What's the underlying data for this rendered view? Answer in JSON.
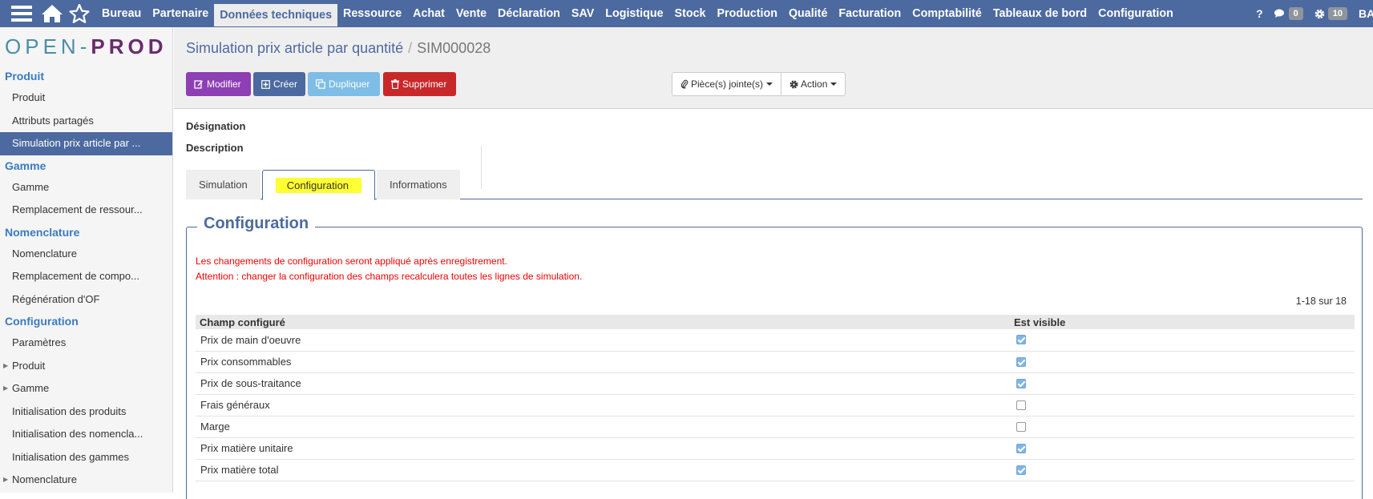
{
  "topbar": {
    "menu": [
      "Bureau",
      "Partenaire",
      "Données techniques",
      "Ressource",
      "Achat",
      "Vente",
      "Déclaration",
      "SAV",
      "Logistique",
      "Stock",
      "Production",
      "Qualité",
      "Facturation",
      "Comptabilité",
      "Tableaux de bord",
      "Configuration"
    ],
    "active_index": 2,
    "help": "?",
    "messages_count": "0",
    "settings_count": "10",
    "user": "BA"
  },
  "logo": {
    "part1": "OPEN",
    "dash": "-",
    "part2": "PROD"
  },
  "sidebar": {
    "items": [
      {
        "type": "section",
        "label": "Produit"
      },
      {
        "type": "item",
        "label": "Produit"
      },
      {
        "type": "item",
        "label": "Attributs partagés"
      },
      {
        "type": "item",
        "label": "Simulation prix article par ...",
        "active": true
      },
      {
        "type": "section",
        "label": "Gamme"
      },
      {
        "type": "item",
        "label": "Gamme"
      },
      {
        "type": "item",
        "label": "Remplacement de ressour..."
      },
      {
        "type": "section",
        "label": "Nomenclature"
      },
      {
        "type": "item",
        "label": "Nomenclature"
      },
      {
        "type": "item",
        "label": "Remplacement de compo..."
      },
      {
        "type": "item",
        "label": "Régénération d'OF"
      },
      {
        "type": "section",
        "label": "Configuration"
      },
      {
        "type": "item",
        "label": "Paramètres"
      },
      {
        "type": "item",
        "label": "Produit",
        "caret": true
      },
      {
        "type": "item",
        "label": "Gamme",
        "caret": true
      },
      {
        "type": "item",
        "label": "Initialisation des produits"
      },
      {
        "type": "item",
        "label": "Initialisation des nomencla..."
      },
      {
        "type": "item",
        "label": "Initialisation des gammes"
      },
      {
        "type": "item",
        "label": "Nomenclature",
        "caret": true
      }
    ]
  },
  "header": {
    "breadcrumb_parent": "Simulation prix article par quantité",
    "breadcrumb_sep": "/",
    "breadcrumb_current": "SIM000028",
    "btn_modifier": "Modifier",
    "btn_creer": "Créer",
    "btn_dupliquer": "Dupliquer",
    "btn_supprimer": "Supprimer",
    "btn_pieces": "Pièce(s) jointe(s)",
    "btn_action": "Action"
  },
  "form": {
    "designation_label": "Désignation",
    "description_label": "Description"
  },
  "tabs": [
    {
      "label": "Simulation",
      "active": false
    },
    {
      "label": "Configuration",
      "active": true
    },
    {
      "label": "Informations",
      "active": false
    }
  ],
  "config": {
    "title": "Configuration",
    "warning1": "Les changements de configuration seront appliqué après enregistrement.",
    "warning2": "Attention : changer la configuration des champs recalculera toutes les lignes de simulation.",
    "pager": "1-18 sur 18",
    "col_field": "Champ configuré",
    "col_visible": "Est visible",
    "rows": [
      {
        "field": "Prix de main d'oeuvre",
        "visible": true
      },
      {
        "field": "Prix consommables",
        "visible": true
      },
      {
        "field": "Prix de sous-traitance",
        "visible": true
      },
      {
        "field": "Frais généraux",
        "visible": false
      },
      {
        "field": "Marge",
        "visible": false
      },
      {
        "field": "Prix matière unitaire",
        "visible": true
      },
      {
        "field": "Prix matière total",
        "visible": true
      }
    ]
  }
}
